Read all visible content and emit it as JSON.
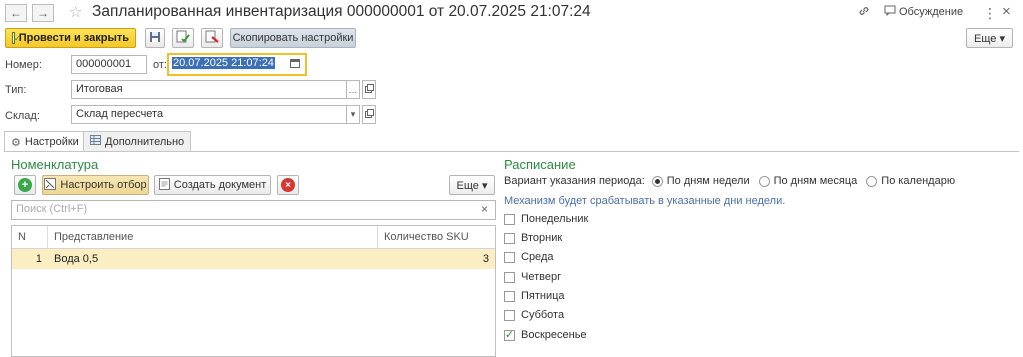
{
  "window": {
    "title": "Запланированная инвентаризация 000000001 от 20.07.2025 21:07:24",
    "discussion_label": "Обсуждение",
    "nav_back": "←",
    "nav_forward": "→",
    "star": "☆",
    "link_icon": "🔗",
    "menu_icon": "⋮",
    "close_icon": "×"
  },
  "toolbar": {
    "post_close_label": "Провести и закрыть",
    "copy_settings_label": "Скопировать настройки",
    "more_label": "Еще ▾"
  },
  "header_fields": {
    "number_label": "Номер:",
    "number_value": "000000001",
    "date_label": "от:",
    "date_value": "20.07.2025 21:07:24",
    "type_label": "Тип:",
    "type_value": "Итоговая",
    "warehouse_label": "Склад:",
    "warehouse_value": "Склад пересчета"
  },
  "tabs": [
    {
      "label": "Настройки",
      "active": true
    },
    {
      "label": "Дополнительно",
      "active": false
    }
  ],
  "nomenclature": {
    "title": "Номенклатура",
    "filter_button": "Настроить отбор",
    "create_doc_button": "Создать документ",
    "more_label": "Еще ▾",
    "search_placeholder": "Поиск (Ctrl+F)",
    "columns": [
      "N",
      "Представление",
      "Количество SKU"
    ],
    "rows": [
      {
        "n": "1",
        "name": "Вода 0,5",
        "sku": "3"
      }
    ]
  },
  "schedule": {
    "title": "Расписание",
    "period_label": "Вариант указания периода:",
    "options": [
      {
        "label": "По дням недели",
        "selected": true
      },
      {
        "label": "По дням месяца",
        "selected": false
      },
      {
        "label": "По календарю",
        "selected": false
      }
    ],
    "hint": "Механизм будет срабатывать в указанные дни недели.",
    "days": [
      {
        "label": "Понедельник",
        "checked": false
      },
      {
        "label": "Вторник",
        "checked": false
      },
      {
        "label": "Среда",
        "checked": false
      },
      {
        "label": "Четверг",
        "checked": false
      },
      {
        "label": "Пятница",
        "checked": false
      },
      {
        "label": "Суббота",
        "checked": false
      },
      {
        "label": "Воскресенье",
        "checked": true
      }
    ]
  }
}
